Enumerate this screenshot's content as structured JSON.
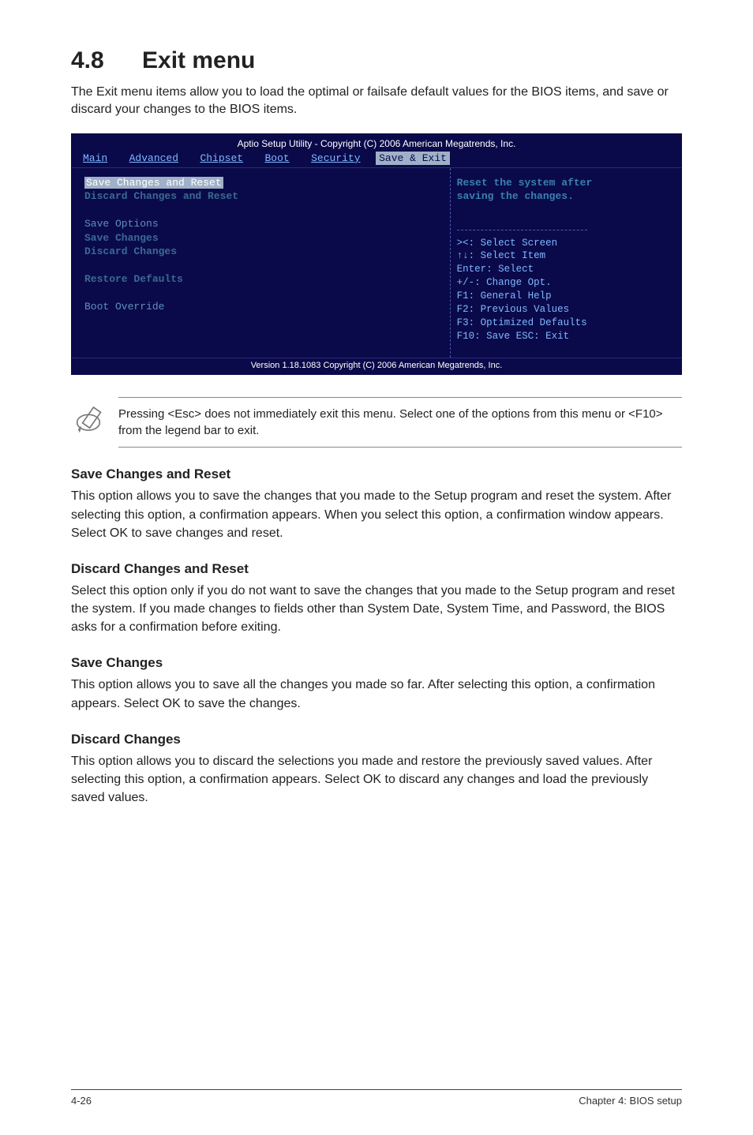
{
  "section": {
    "number": "4.8",
    "title": "Exit menu"
  },
  "intro": "The Exit menu items allow you to load the optimal or failsafe default values for the BIOS items, and save or discard your changes to the BIOS items.",
  "bios": {
    "topbar": "Aptio Setup Utility - Copyright (C) 2006 American Megatrends, Inc.",
    "tabs": [
      "Main",
      "Advanced",
      "Chipset",
      "Boot",
      "Security",
      "Save & Exit"
    ],
    "active_tab": "Save & Exit",
    "left": {
      "selected": "Save Changes and Reset",
      "item2": "Discard Changes and Reset",
      "group_label": "Save Options",
      "item3": "Save Changes",
      "item4": "Discard Changes",
      "item5": "Restore Defaults",
      "item6": "Boot Override"
    },
    "right": {
      "help_line1": "Reset the system after",
      "help_line2": "saving the changes.",
      "legend1": "><: Select Screen",
      "legend2": "↑↓: Select Item",
      "legend3": "Enter: Select",
      "legend4": "+/-: Change Opt.",
      "legend5": "F1: General Help",
      "legend6": "F2: Previous Values",
      "legend7": "F3: Optimized Defaults",
      "legend8": "F10: Save  ESC: Exit"
    },
    "versionbar": "Version 1.18.1083 Copyright (C) 2006 American Megatrends, Inc."
  },
  "note": "Pressing <Esc> does not immediately exit this menu. Select one of the options from this menu or <F10> from the legend bar to exit.",
  "s1": {
    "heading": "Save Changes and Reset",
    "body": "This option allows you to save the changes that you made to the Setup program and reset the system. After selecting this option, a confirmation appears. When you select this option, a confirmation window appears. Select OK to save changes and reset."
  },
  "s2": {
    "heading": "Discard Changes and Reset",
    "body": "Select this option only if you do not want to save the changes that you  made to the Setup program and reset the system. If you made changes to fields other than System Date, System Time, and Password, the BIOS asks for a confirmation before exiting."
  },
  "s3": {
    "heading": "Save Changes",
    "body": "This option allows you to save all the changes you made so far. After selecting this option, a confirmation appears. Select OK to save the changes."
  },
  "s4": {
    "heading": "Discard Changes",
    "body": "This option allows you to discard the selections you made and restore the previously saved values. After selecting this option, a confirmation appears. Select OK to discard any changes and load the previously saved values."
  },
  "footer": {
    "left": "4-26",
    "right": "Chapter 4: BIOS setup"
  }
}
